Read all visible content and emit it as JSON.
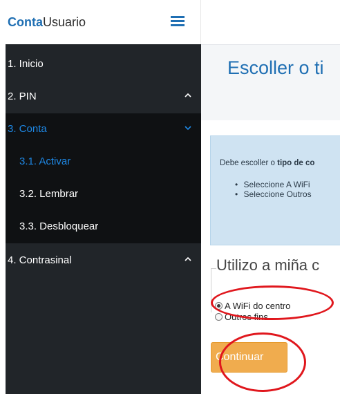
{
  "brand": {
    "strong": "Conta",
    "rest": "Usuario"
  },
  "sidebar": {
    "items": [
      {
        "label": "1. Inicio"
      },
      {
        "label": "2. PIN"
      },
      {
        "label": "3. Conta"
      },
      {
        "label": "4. Contrasinal"
      }
    ],
    "subitems": [
      {
        "label": "3.1. Activar"
      },
      {
        "label": "3.2. Lembrar"
      },
      {
        "label": "3.3. Desbloquear"
      }
    ]
  },
  "main": {
    "title": "Escoller o ti",
    "info": {
      "text_prefix": "Debe escoller o ",
      "text_bold": "tipo de co",
      "bullets": [
        {
          "prefix": "Seleccione ",
          "bold": "A WiFi"
        },
        {
          "prefix": "Seleccione ",
          "bold": "Outros"
        }
      ]
    },
    "fieldset_legend": "Utilizo a miña c",
    "options": [
      {
        "label": "A WiFi do centro",
        "checked": true
      },
      {
        "label": "Outros fins",
        "checked": false
      }
    ],
    "continue_label": "Continuar"
  },
  "colors": {
    "accent": "#1f6fb3",
    "sidebar_bg": "#212529",
    "active_link": "#1e88e5",
    "button": "#f0ac4e",
    "annotation": "#e0171d"
  }
}
